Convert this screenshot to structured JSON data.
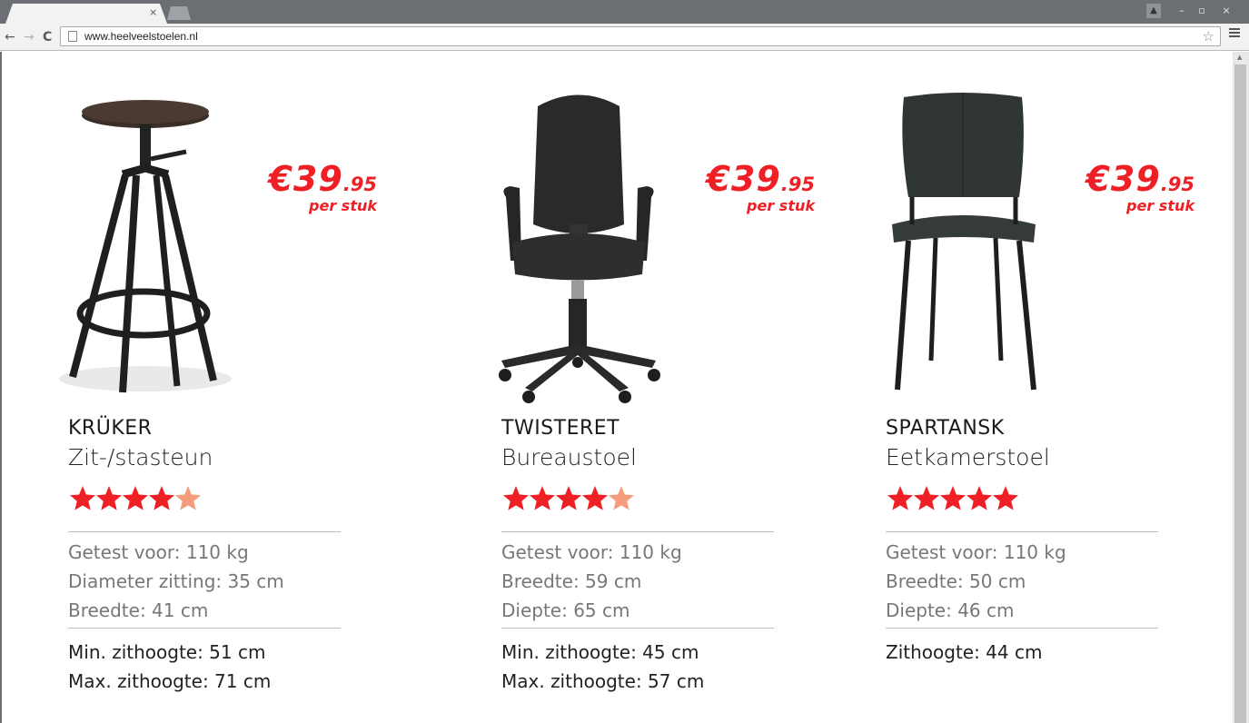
{
  "browser": {
    "tab_close": "×",
    "url": "www.heelveelstoelen.nl"
  },
  "colors": {
    "price": "#ee2026",
    "star_full": "#ee2026",
    "star_half": "#f49c7c"
  },
  "products": [
    {
      "name": "KRÜKER",
      "type": "Zit-/stasteun",
      "price_symbol": "€",
      "price_whole": "39",
      "price_cents": ".95",
      "price_unit": "per stuk",
      "rating": 4.5,
      "specs": [
        "Getest voor: 110 kg",
        "Diameter zitting: 35 cm",
        "Breedte: 41 cm"
      ],
      "heights": [
        "Min. zithoogte: 51 cm",
        "Max. zithoogte: 71 cm"
      ],
      "image": "bar-stool-icon"
    },
    {
      "name": "TWISTERET",
      "type": "Bureaustoel",
      "price_symbol": "€",
      "price_whole": "39",
      "price_cents": ".95",
      "price_unit": "per stuk",
      "rating": 4.5,
      "specs": [
        "Getest voor: 110 kg",
        "Breedte: 59 cm",
        "Diepte: 65 cm"
      ],
      "heights": [
        "Min. zithoogte: 45 cm",
        "Max. zithoogte: 57 cm"
      ],
      "image": "office-chair-icon"
    },
    {
      "name": "SPARTANSK",
      "type": "Eetkamerstoel",
      "price_symbol": "€",
      "price_whole": "39",
      "price_cents": ".95",
      "price_unit": "per stuk",
      "rating": 5,
      "specs": [
        "Getest voor: 110 kg",
        "Breedte: 50 cm",
        "Diepte: 46 cm"
      ],
      "heights": [
        "Zithoogte: 44 cm"
      ],
      "image": "dining-chair-icon"
    }
  ]
}
